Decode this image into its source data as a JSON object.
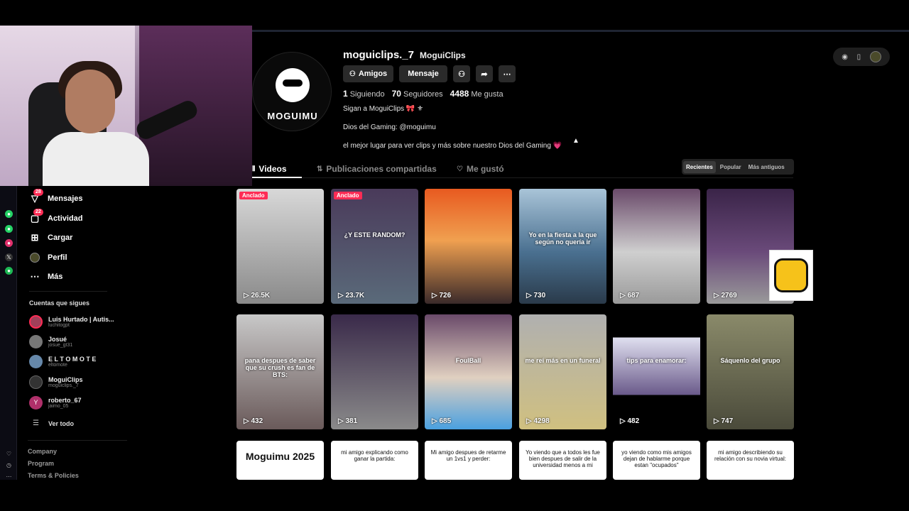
{
  "profile": {
    "username": "moguiclips._7",
    "display_name": "MoguiClips",
    "logo_text": "MOGUIMU",
    "buttons": {
      "friends": "Amigos",
      "message": "Mensaje"
    },
    "stats": [
      {
        "value": "1",
        "label": "Siguiendo"
      },
      {
        "value": "70",
        "label": "Seguidores"
      },
      {
        "value": "4488",
        "label": "Me gusta"
      }
    ],
    "bio": [
      "Sigan a MoguiClips 🎀 ⚜",
      "Dios del Gaming: @moguimu",
      "el mejor lugar para ver clips y más sobre nuestro Dios del Gaming 💗"
    ]
  },
  "tabs": [
    "Videos",
    "Publicaciones compartidas",
    "Me gustó"
  ],
  "sort": [
    "Recientes",
    "Popular",
    "Más antiguos"
  ],
  "sidebar": {
    "nav": [
      {
        "label": "Mensajes",
        "badge": "28",
        "icon": "send-icon"
      },
      {
        "label": "Actividad",
        "badge": "22",
        "icon": "inbox-icon"
      },
      {
        "label": "Cargar",
        "badge": "",
        "icon": "upload-icon"
      },
      {
        "label": "Perfil",
        "badge": "",
        "icon": "profile-icon"
      },
      {
        "label": "Más",
        "badge": "",
        "icon": "more-icon"
      }
    ],
    "following_title": "Cuentas que sigues",
    "following": [
      {
        "name": "Luis Hurtado | Autis...",
        "handle": "luchitogpt",
        "color": "#a0405a"
      },
      {
        "name": "Josué",
        "handle": "josue_gt31",
        "color": "#777777"
      },
      {
        "name": "E L T O M O T E",
        "handle": "eltomote",
        "color": "#6688aa"
      },
      {
        "name": "MoguiClips",
        "handle": "moguiclips._7",
        "color": "#333333"
      },
      {
        "name": "roberto_67",
        "handle": "jaimo_05",
        "color": "#b0306a"
      }
    ],
    "see_all": "Ver todo",
    "footer": [
      "Company",
      "Program",
      "Terms & Policies"
    ]
  },
  "videos": [
    {
      "views": "26.5K",
      "pinned": "Anclado",
      "bg": "linear-gradient(180deg,#d8d8d8,#8a8a8a)",
      "caption": ""
    },
    {
      "views": "23.7K",
      "pinned": "Anclado",
      "bg": "linear-gradient(180deg,#4a3a5a,#5a6a7a)",
      "caption": "¿Y ESTE RANDOM?"
    },
    {
      "views": "726",
      "pinned": "",
      "bg": "linear-gradient(180deg,#e85a20,#f0a050 45%,#3a2a2a)",
      "caption": ""
    },
    {
      "views": "730",
      "pinned": "",
      "bg": "linear-gradient(180deg,#a9c4d8,#4a7090 55%,#2a3a4a)",
      "caption": "Yo en la fiesta a la que según no quería ir"
    },
    {
      "views": "687",
      "pinned": "",
      "bg": "linear-gradient(180deg,#6a4a6a,#cfcfcf 55%,#9a9a9a)",
      "caption": ""
    },
    {
      "views": "2769",
      "pinned": "",
      "bg": "linear-gradient(180deg,#3a2448,#6a4a7a 55%,#9a9a9a)",
      "caption": ""
    },
    {
      "views": "432",
      "pinned": "",
      "bg": "linear-gradient(180deg,#c8c8c8,#6a5a5a)",
      "caption": "pana despues de saber que su crush es fan de BTS:"
    },
    {
      "views": "381",
      "pinned": "",
      "bg": "linear-gradient(180deg,#3a2a4a,#8a8a8a)",
      "caption": ""
    },
    {
      "views": "685",
      "pinned": "",
      "bg": "linear-gradient(180deg,#6a4a6a,#e0d0c0 55%,#4aa0e0)",
      "caption": "FoulBall"
    },
    {
      "views": "4298",
      "pinned": "",
      "bg": "linear-gradient(180deg,#b0b0b0,#d0c080)",
      "caption": "me reí más en un funeral"
    },
    {
      "views": "482",
      "pinned": "",
      "bg": "linear-gradient(180deg,#000,#000 20%,#e0e0f0 20%,#6a5a8a 70%,#000 70%)",
      "caption": "tips para enamorar:"
    },
    {
      "views": "747",
      "pinned": "",
      "bg": "linear-gradient(180deg,#8a8a6a,#4a4a3a)",
      "caption": "Sáquenlo del grupo"
    },
    {
      "views": "",
      "pinned": "",
      "bg": "#ffffff",
      "caption": "Moguimu 2025",
      "white": true
    },
    {
      "views": "",
      "pinned": "",
      "bg": "#ffffff",
      "caption": "mi amigo explicando como ganar la partida:",
      "white": true
    },
    {
      "views": "",
      "pinned": "",
      "bg": "#ffffff",
      "caption": "Mi amigo despues de retarme un 1vs1 y perder:",
      "white": true
    },
    {
      "views": "",
      "pinned": "",
      "bg": "#ffffff",
      "caption": "Yo viendo que a todos les fue bien despues de salir de la universidad menos a mi",
      "white": true
    },
    {
      "views": "",
      "pinned": "",
      "bg": "#ffffff",
      "caption": "yo viendo como mis amigos dejan de hablarme porque estan \"ocupados\"",
      "white": true
    },
    {
      "views": "",
      "pinned": "",
      "bg": "#ffffff",
      "caption": "mi amigo describiendo su relación con su novia virtual:",
      "white": true
    }
  ],
  "colors": {
    "accent": "#fe2c55",
    "bg": "#000000",
    "button": "#2a2a2a"
  }
}
